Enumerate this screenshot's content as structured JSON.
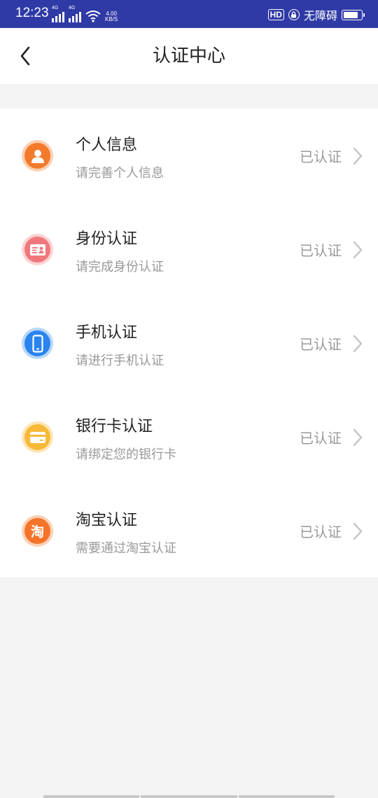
{
  "status_bar": {
    "time": "12:23",
    "signal_1_label": "4G",
    "signal_2_label": "4G",
    "net_speed_value": "4.00",
    "net_speed_unit": "KB/S",
    "hd_label": "HD",
    "accessibility_label": "无障碍",
    "icons": [
      "signal-icon",
      "signal-icon",
      "wifi-icon",
      "hd-icon",
      "lock-icon",
      "battery-icon"
    ]
  },
  "header": {
    "title": "认证中心",
    "back_icon": "chevron-left-icon"
  },
  "items": [
    {
      "title": "个人信息",
      "subtitle": "请完善个人信息",
      "status": "已认证",
      "icon": "person-icon",
      "color": "#f47a2b",
      "ring": "#fbd0b3"
    },
    {
      "title": "身份认证",
      "subtitle": "请完成身份认证",
      "status": "已认证",
      "icon": "id-card-icon",
      "color": "#f0787c",
      "ring": "#fbd3d4"
    },
    {
      "title": "手机认证",
      "subtitle": "请进行手机认证",
      "status": "已认证",
      "icon": "phone-icon",
      "color": "#2a84ee",
      "ring": "#b9d7fa"
    },
    {
      "title": "银行卡认证",
      "subtitle": "请绑定您的银行卡",
      "status": "已认证",
      "icon": "bank-card-icon",
      "color": "#f8b938",
      "ring": "#fde6b6"
    },
    {
      "title": "淘宝认证",
      "subtitle": "需要通过淘宝认证",
      "status": "已认证",
      "icon": "taobao-icon",
      "icon_text": "淘",
      "color": "#f4742a",
      "ring": "#fcd0b5"
    }
  ],
  "colors": {
    "status_bar": "#2f3aa6",
    "page_background": "#f4f4f4",
    "muted_text": "#999999"
  }
}
